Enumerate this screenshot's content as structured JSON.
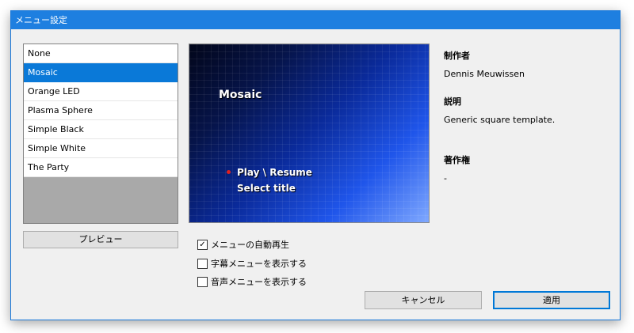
{
  "window": {
    "title": "メニュー設定"
  },
  "template_list": {
    "items": [
      {
        "label": "None"
      },
      {
        "label": "Mosaic"
      },
      {
        "label": "Orange LED"
      },
      {
        "label": "Plasma Sphere"
      },
      {
        "label": "Simple Black"
      },
      {
        "label": "Simple White"
      },
      {
        "label": "The Party"
      }
    ],
    "selected": "Mosaic"
  },
  "preview_button": {
    "label": "プレビュー"
  },
  "preview": {
    "title": "Mosaic",
    "menu_items": [
      {
        "label": "Play \\ Resume"
      },
      {
        "label": "Select title"
      }
    ]
  },
  "info": {
    "author_label": "制作者",
    "author": "Dennis Meuwissen",
    "description_label": "説明",
    "description": "Generic square template.",
    "copyright_label": "著作権",
    "copyright": "-"
  },
  "options": {
    "autoplay": {
      "label": "メニューの自動再生",
      "checked": true
    },
    "subtitle_menu": {
      "label": "字幕メニューを表示する",
      "checked": false
    },
    "audio_menu": {
      "label": "音声メニューを表示する",
      "checked": false
    }
  },
  "buttons": {
    "cancel": "キャンセル",
    "apply": "適用"
  },
  "colors": {
    "accent": "#0a79d8",
    "titlebar": "#1e7fe0",
    "bullet": "#e02020"
  }
}
